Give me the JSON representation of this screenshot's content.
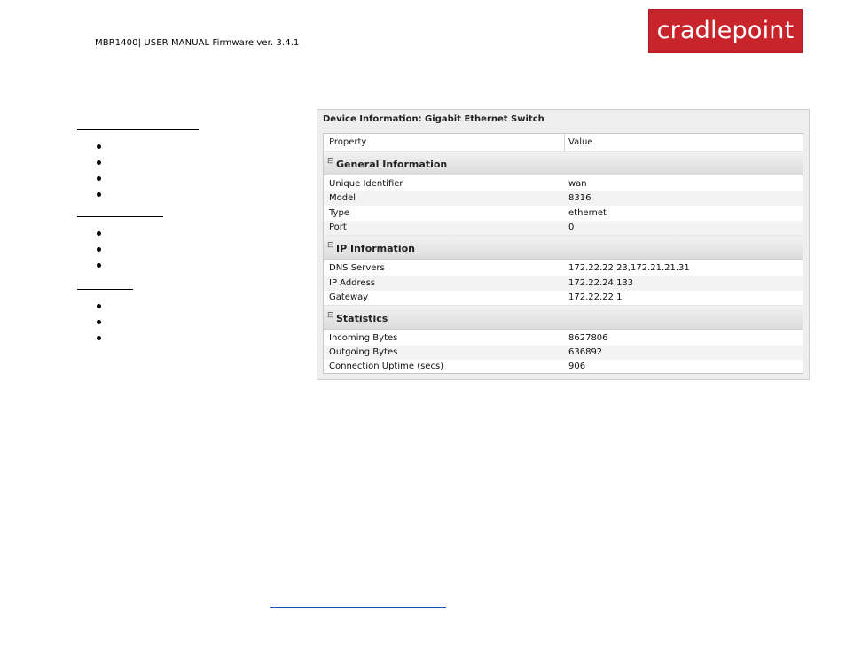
{
  "header": {
    "manual_text": "MBR1400| USER MANUAL Firmware ver. 3.4.1",
    "logo_text": "cradlepoint"
  },
  "colors": {
    "brand_red": "#c8242b",
    "link_blue": "#1a4fb8"
  },
  "panel": {
    "title": "Device Information: Gigabit Ethernet Switch",
    "columns": [
      "Property",
      "Value"
    ],
    "sections": [
      {
        "title": "General Information",
        "rows": [
          {
            "property": "Unique Identifier",
            "value": "wan"
          },
          {
            "property": "Model",
            "value": "8316"
          },
          {
            "property": "Type",
            "value": "ethernet"
          },
          {
            "property": "Port",
            "value": "0"
          }
        ]
      },
      {
        "title": "IP Information",
        "rows": [
          {
            "property": "DNS Servers",
            "value": "172.22.22.23,172.21.21.31"
          },
          {
            "property": "IP Address",
            "value": "172.22.24.133"
          },
          {
            "property": "Gateway",
            "value": "172.22.22.1"
          }
        ]
      },
      {
        "title": "Statistics",
        "rows": [
          {
            "property": "Incoming Bytes",
            "value": "8627806"
          },
          {
            "property": "Outgoing Bytes",
            "value": "636892"
          },
          {
            "property": "Connection Uptime (secs)",
            "value": "906"
          }
        ]
      }
    ],
    "toggle_glyph": "⊟"
  }
}
